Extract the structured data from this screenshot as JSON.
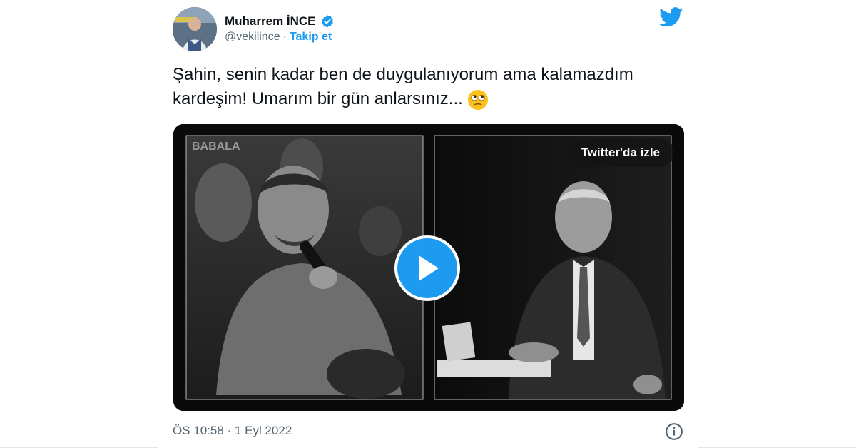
{
  "tweet": {
    "author_name": "Muharrem İNCE",
    "handle": "@vekilince",
    "separator": "·",
    "follow_label": "Takip et",
    "text": "Şahin, senin kadar ben de duygulanıyorum ama kalamazdım kardeşim! Umarım bir gün anlarsınız...",
    "emoji_icon": "face-with-rolling-eyes-icon",
    "timestamp": "ÖS 10:58 · 1 Eyl 2022"
  },
  "media": {
    "watch_label": "Twitter'da izle",
    "watermark": "BABALA",
    "play_icon": "play-icon"
  },
  "icons": {
    "brand": "twitter-bird-icon",
    "verified": "verified-badge-icon",
    "info": "info-icon"
  },
  "colors": {
    "accent": "#1d9bf0",
    "text": "#0f1419",
    "secondary": "#536471"
  }
}
